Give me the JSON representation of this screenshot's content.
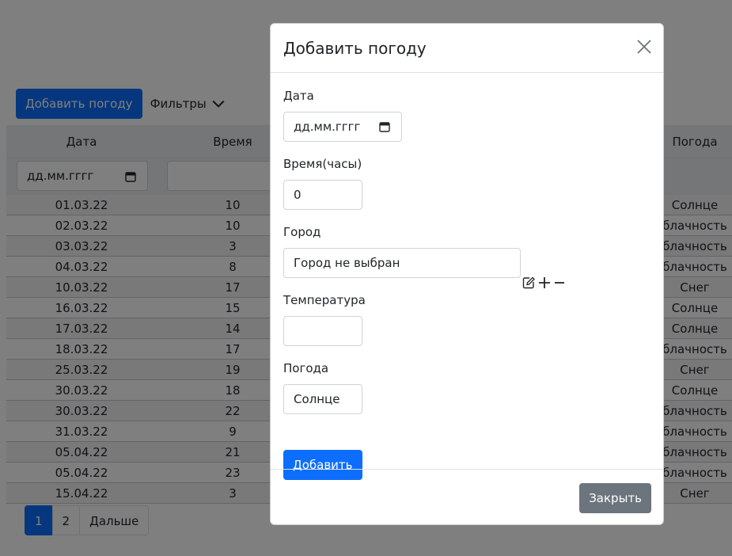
{
  "toolbar": {
    "add_button": "Добавить погоду",
    "filters_label": "Фильтры"
  },
  "table": {
    "headers": {
      "date": "Дата",
      "time": "Время",
      "weather": "Погода"
    },
    "date_filter_placeholder": "дд.мм.гггг",
    "rows": [
      {
        "date": "01.03.22",
        "time": "10",
        "weather": "Солнце"
      },
      {
        "date": "02.03.22",
        "time": "10",
        "weather": "блачность"
      },
      {
        "date": "03.03.22",
        "time": "3",
        "weather": "блачность"
      },
      {
        "date": "04.03.22",
        "time": "8",
        "weather": "блачность"
      },
      {
        "date": "10.03.22",
        "time": "17",
        "weather": "Снег"
      },
      {
        "date": "16.03.22",
        "time": "15",
        "weather": "Солнце"
      },
      {
        "date": "17.03.22",
        "time": "14",
        "weather": "Солнце"
      },
      {
        "date": "18.03.22",
        "time": "17",
        "weather": "блачность"
      },
      {
        "date": "25.03.22",
        "time": "19",
        "weather": "Снег"
      },
      {
        "date": "30.03.22",
        "time": "18",
        "weather": "Солнце"
      },
      {
        "date": "30.03.22",
        "time": "22",
        "weather": "блачность"
      },
      {
        "date": "31.03.22",
        "time": "9",
        "weather": "блачность"
      },
      {
        "date": "05.04.22",
        "time": "21",
        "weather": "блачность"
      },
      {
        "date": "05.04.22",
        "time": "23",
        "weather": "блачность"
      },
      {
        "date": "15.04.22",
        "time": "3",
        "weather": "Снег"
      }
    ]
  },
  "pagination": {
    "pages": [
      "1",
      "2"
    ],
    "next": "Дальше",
    "active": "1"
  },
  "modal": {
    "title": "Добавить погоду",
    "date_label": "Дата",
    "date_placeholder": "дд.мм.гггг",
    "time_label": "Время(часы)",
    "time_value": "0",
    "city_label": "Город",
    "city_value": "Город не выбран",
    "temp_label": "Температура",
    "temp_value": "",
    "weather_label": "Погода",
    "weather_value": "Солнце",
    "submit": "Добавить",
    "close": "Закрыть"
  },
  "colors": {
    "primary": "#0d6efd",
    "secondary": "#6c757d",
    "backdrop": "rgba(0,0,0,0.5)"
  },
  "icons": [
    "calendar-icon",
    "chevron-down-icon",
    "close-icon",
    "edit-icon",
    "plus-icon",
    "minus-icon"
  ]
}
